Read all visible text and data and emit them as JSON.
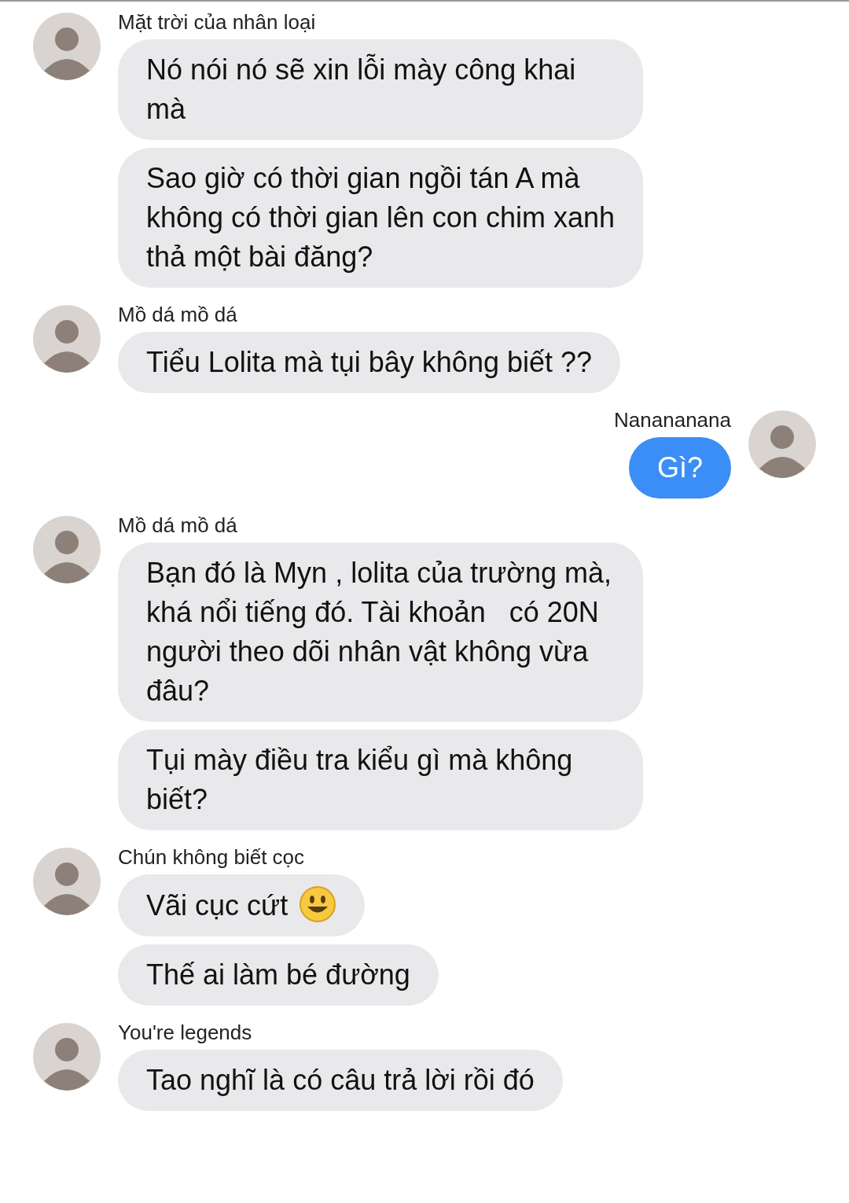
{
  "groups": [
    {
      "kind": "incoming",
      "sender": "Mặt trời của nhân loại",
      "messages": [
        {
          "text": "Nó nói nó sẽ xin lỗi mày công khai mà"
        },
        {
          "text": "Sao giờ có thời gian ngồi tán A mà không có thời gian lên con chim xanh thả một bài đăng?"
        }
      ]
    },
    {
      "kind": "incoming",
      "sender": "Mồ dá mồ dá",
      "messages": [
        {
          "text": "Tiểu Lolita mà tụi bây không biết ??"
        }
      ]
    },
    {
      "kind": "outgoing",
      "sender": "Nanananana",
      "messages": [
        {
          "text": "Gì?"
        }
      ]
    },
    {
      "kind": "incoming",
      "sender": "Mồ dá mồ dá",
      "messages": [
        {
          "text": "Bạn đó là Myn , lolita của trường mà, khá nổi tiếng đó. Tài khoản   có 20N người theo dõi nhân vật không vừa đâu?"
        },
        {
          "text": "Tụi mày điều tra kiểu gì mà không biết?"
        }
      ]
    },
    {
      "kind": "incoming",
      "sender": "Chún không biết cọc",
      "messages": [
        {
          "text": "Vãi cục cứt",
          "emoji": true
        },
        {
          "text": "Thế ai làm bé đường"
        }
      ]
    },
    {
      "kind": "incoming",
      "sender": "You're legends",
      "messages": [
        {
          "text": "Tao nghĩ là có câu trả lời rồi đó"
        }
      ]
    }
  ]
}
